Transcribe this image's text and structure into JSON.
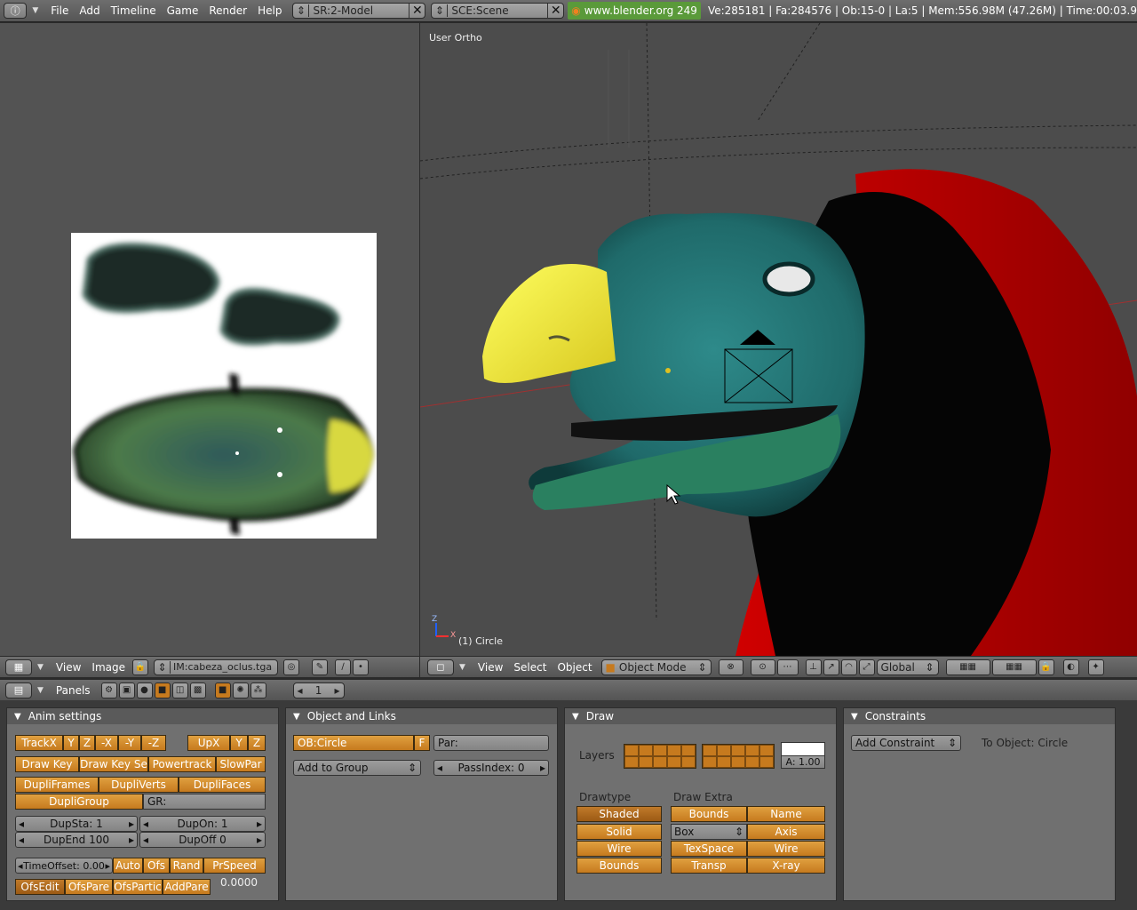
{
  "menubar": {
    "menus": [
      "File",
      "Add",
      "Timeline",
      "Game",
      "Render",
      "Help"
    ],
    "screen": "SR:2-Model",
    "scene": "SCE:Scene",
    "link": "www.blender.org 249",
    "stats": "Ve:285181 | Fa:284576 | Ob:15-0 | La:5  | Mem:556.98M (47.26M)  | Time:00:03.9"
  },
  "view3d": {
    "view_label": "User Ortho",
    "object_label": "(1) Circle",
    "axis_x": "X",
    "axis_z": "Z"
  },
  "image_header": {
    "menus": [
      "View",
      "Image"
    ],
    "image_name": "IM:cabeza_oclus.tga"
  },
  "view3d_header": {
    "menus": [
      "View",
      "Select",
      "Object"
    ],
    "mode": "Object Mode",
    "orientation": "Global"
  },
  "buttons_header": {
    "panels_label": "Panels",
    "frame": "1"
  },
  "anim_panel": {
    "title": "Anim settings",
    "track": [
      "TrackX",
      "Y",
      "Z",
      "-X",
      "-Y",
      "-Z"
    ],
    "up": [
      "UpX",
      "Y",
      "Z"
    ],
    "row2": [
      "Draw Key",
      "Draw Key Se",
      "Powertrack",
      "SlowPar"
    ],
    "dupli": [
      "DupliFrames",
      "DupliVerts",
      "DupliFaces"
    ],
    "dupligroup": "DupliGroup",
    "gr": "GR:",
    "dupsta": "DupSta: 1",
    "dupon": "DupOn: 1",
    "dupend": "DupEnd 100",
    "dupoff": "DupOff 0",
    "timeoffset": "TimeOffset: 0.00",
    "offs": [
      "Auto",
      "Ofs",
      "Rand",
      "PrSpeed"
    ],
    "ofsrow": [
      "OfsEdit",
      "OfsPare",
      "OfsPartic",
      "AddPare"
    ],
    "ofsval": "0.0000"
  },
  "obj_panel": {
    "title": "Object and Links",
    "ob": "OB:Circle",
    "f": "F",
    "par": "Par:",
    "group": "Add to Group",
    "passindex": "PassIndex: 0"
  },
  "draw_panel": {
    "title": "Draw",
    "layers_label": "Layers",
    "alpha": "A: 1.00",
    "drawtype_label": "Drawtype",
    "drawtype": [
      "Shaded",
      "Solid",
      "Wire",
      "Bounds"
    ],
    "extra_label": "Draw Extra",
    "extra_left": [
      "Bounds",
      "Box",
      "TexSpace",
      "Transp"
    ],
    "extra_right": [
      "Name",
      "Axis",
      "Wire",
      "X-ray"
    ]
  },
  "constraints_panel": {
    "title": "Constraints",
    "add": "Add Constraint",
    "to_object": "To Object: Circle"
  }
}
